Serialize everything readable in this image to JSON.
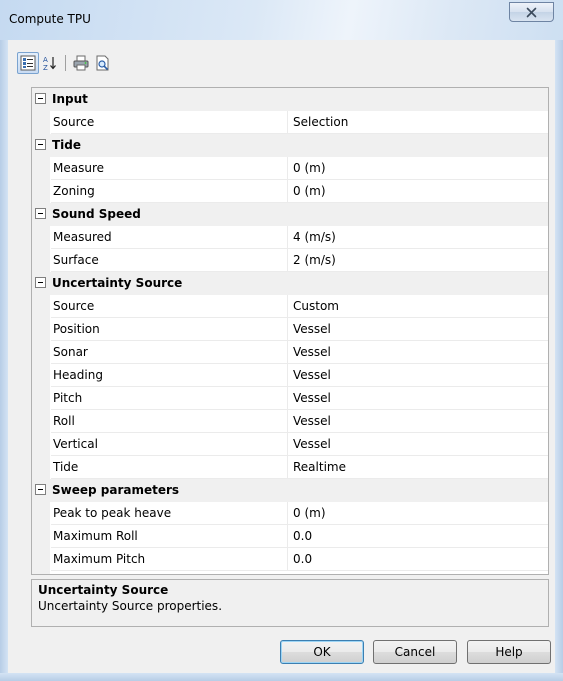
{
  "window": {
    "title": "Compute TPU"
  },
  "toolbar": {
    "buttons": [
      {
        "icon": "categorized-icon",
        "active": true
      },
      {
        "icon": "sort-alpha-icon",
        "active": false
      },
      {
        "icon": "print-icon",
        "active": false
      },
      {
        "icon": "preview-icon",
        "active": false
      }
    ]
  },
  "grid": {
    "categories": [
      {
        "name": "Input",
        "rows": [
          {
            "name": "Source",
            "value": "Selection"
          }
        ]
      },
      {
        "name": "Tide",
        "rows": [
          {
            "name": "Measure",
            "value": "0 (m)"
          },
          {
            "name": "Zoning",
            "value": "0 (m)"
          }
        ]
      },
      {
        "name": "Sound Speed",
        "rows": [
          {
            "name": "Measured",
            "value": "4 (m/s)"
          },
          {
            "name": "Surface",
            "value": "2 (m/s)"
          }
        ]
      },
      {
        "name": "Uncertainty Source",
        "rows": [
          {
            "name": "Source",
            "value": "Custom"
          },
          {
            "name": "Position",
            "value": "Vessel"
          },
          {
            "name": "Sonar",
            "value": "Vessel"
          },
          {
            "name": "Heading",
            "value": "Vessel"
          },
          {
            "name": "Pitch",
            "value": "Vessel"
          },
          {
            "name": "Roll",
            "value": "Vessel"
          },
          {
            "name": "Vertical",
            "value": "Vessel"
          },
          {
            "name": "Tide",
            "value": "Realtime"
          }
        ]
      },
      {
        "name": "Sweep parameters",
        "rows": [
          {
            "name": "Peak to peak heave",
            "value": "0 (m)"
          },
          {
            "name": "Maximum Roll",
            "value": "0.0"
          },
          {
            "name": "Maximum Pitch",
            "value": "0.0"
          }
        ]
      }
    ]
  },
  "help": {
    "title": "Uncertainty Source",
    "description": "Uncertainty Source properties."
  },
  "buttons": {
    "ok": "OK",
    "cancel": "Cancel",
    "help": "Help"
  }
}
